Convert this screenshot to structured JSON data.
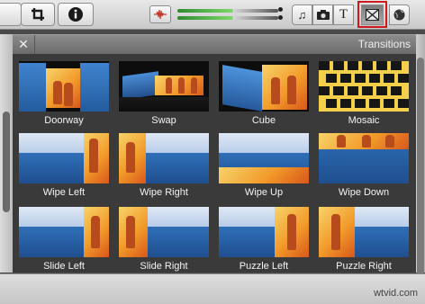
{
  "window": {
    "panel_title": "Transitions",
    "close_symbol": "✕",
    "watermark": "wtvid.com"
  },
  "toolbar": {
    "crop_icon": "crop-icon",
    "info_icon": "info-icon",
    "audio_levels": {
      "left": 0.7,
      "right": 0.7
    },
    "browser_buttons": [
      {
        "name": "music-icon",
        "glyph": "♫"
      },
      {
        "name": "photo-icon",
        "glyph": "📷"
      },
      {
        "name": "titles-icon",
        "glyph": "T"
      },
      {
        "name": "transitions-icon",
        "glyph": "⊠",
        "selected": true
      },
      {
        "name": "maps-icon",
        "glyph": "🌐"
      }
    ]
  },
  "transitions": [
    {
      "label": "Doorway"
    },
    {
      "label": "Swap"
    },
    {
      "label": "Cube"
    },
    {
      "label": "Mosaic"
    },
    {
      "label": "Wipe Left"
    },
    {
      "label": "Wipe Right"
    },
    {
      "label": "Wipe Up"
    },
    {
      "label": "Wipe Down"
    },
    {
      "label": "Slide Left"
    },
    {
      "label": "Slide Right"
    },
    {
      "label": "Puzzle Left"
    },
    {
      "label": "Puzzle Right"
    }
  ],
  "colors": {
    "accent_selected": "#d0191c",
    "panel_bg": "#3a3a3a",
    "label_text": "#f4f4f4"
  }
}
